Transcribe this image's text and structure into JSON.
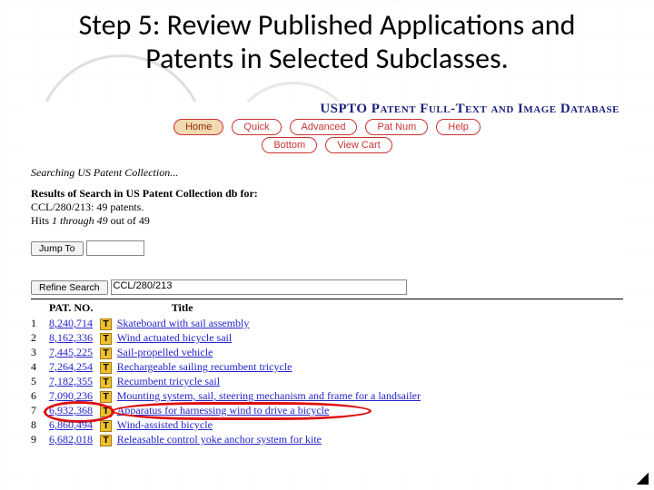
{
  "slide": {
    "title": "Step 5: Review Published Applications and Patents in Selected Subclasses."
  },
  "uspto": {
    "db_title": "USPTO Patent Full-Text and Image Database",
    "buttons_row1": {
      "home": "Home",
      "quick": "Quick",
      "advanced": "Advanced",
      "patnum": "Pat Num",
      "help": "Help"
    },
    "buttons_row2": {
      "bottom": "Bottom",
      "viewcart": "View Cart"
    },
    "searching_line": "Searching US Patent Collection...",
    "results_heading": "Results of Search in US Patent Collection db for:",
    "results_query_line": "CCL/280/213: 49 patents.",
    "hits_prefix": "Hits ",
    "hits_range": "1 through 49",
    "hits_suffix": " out of 49",
    "jump_to_label": "Jump To",
    "refine_label": "Refine Search",
    "refine_value": "CCL/280/213",
    "headers": {
      "patno": "PAT. NO.",
      "title": "Title",
      "t_badge": "T"
    },
    "rows": [
      {
        "n": "1",
        "pat": "8,240,714",
        "title": "Skateboard with sail assembly"
      },
      {
        "n": "2",
        "pat": "8,162,336",
        "title": "Wind actuated bicycle sail"
      },
      {
        "n": "3",
        "pat": "7,445,225",
        "title": "Sail-propelled vehicle"
      },
      {
        "n": "4",
        "pat": "7,264,254",
        "title": "Rechargeable sailing recumbent tricycle"
      },
      {
        "n": "5",
        "pat": "7,182,355",
        "title": "Recumbent tricycle sail"
      },
      {
        "n": "6",
        "pat": "7,090,236",
        "title": "Mounting system, sail, steering mechanism and frame for a landsailer"
      },
      {
        "n": "7",
        "pat": "6,932,368",
        "title": "Apparatus for harnessing wind to drive a bicycle"
      },
      {
        "n": "8",
        "pat": "6,860,494",
        "title": "Wind-assisted bicycle"
      },
      {
        "n": "9",
        "pat": "6,682,018",
        "title": "Releasable control yoke anchor system for kite"
      }
    ]
  }
}
